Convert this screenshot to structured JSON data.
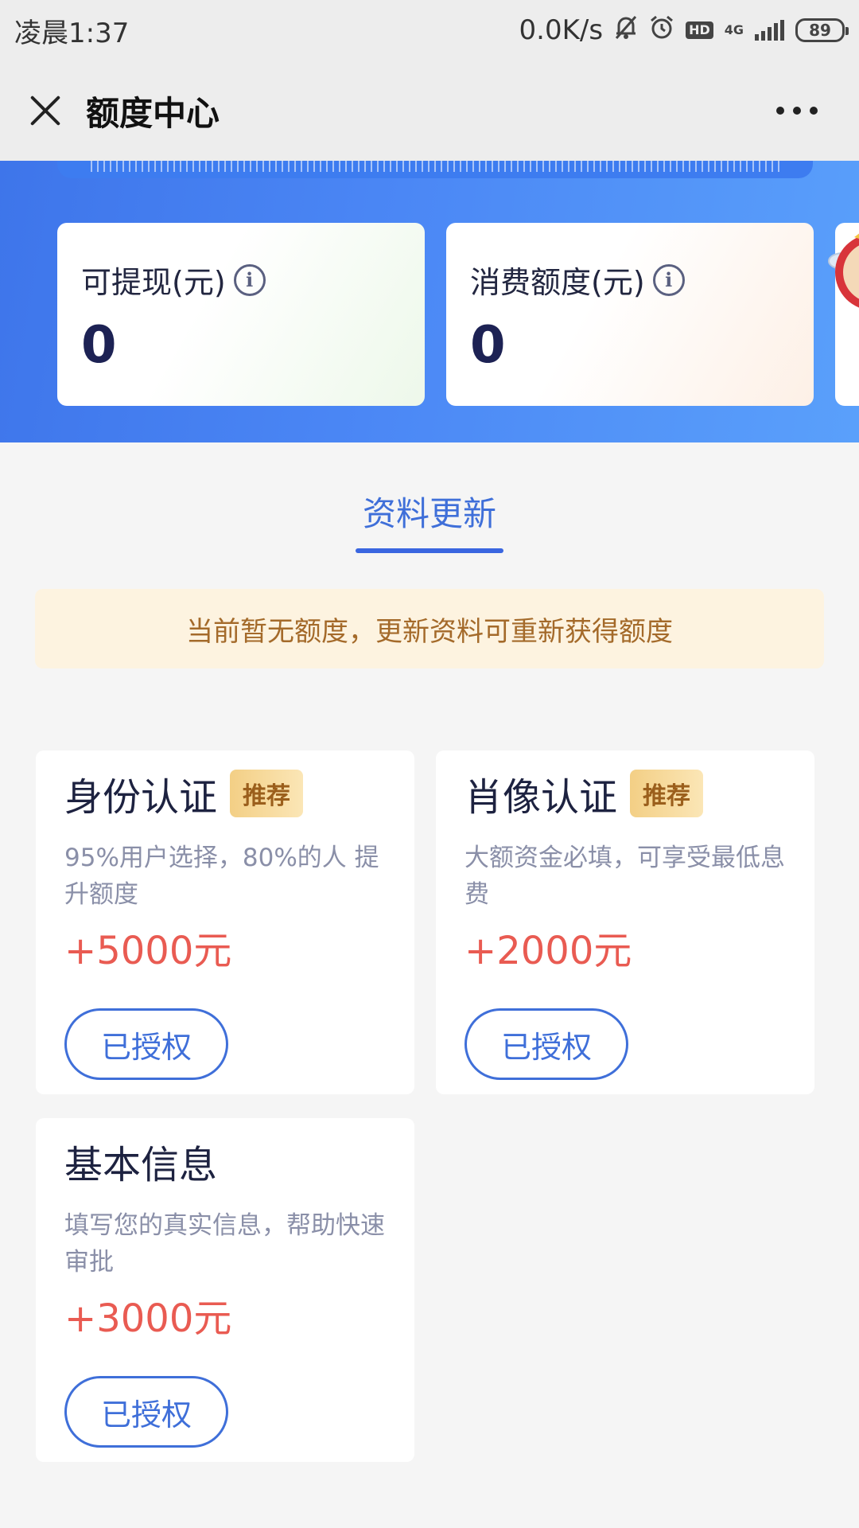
{
  "status_bar": {
    "time": "凌晨1:37",
    "speed": "0.0K/s",
    "network": "4G",
    "hd": "HD",
    "battery": "89"
  },
  "nav": {
    "title": "额度中心"
  },
  "balances": [
    {
      "label": "可提现(元)",
      "value": "0"
    },
    {
      "label": "消费额度(元)",
      "value": "0"
    }
  ],
  "tab": {
    "label": "资料更新"
  },
  "notice": "当前暂无额度，更新资料可重新获得额度",
  "auth_cards": [
    {
      "title": "身份认证",
      "badge": "推荐",
      "desc": "95%用户选择，80%的人 提升额度",
      "bonus": "+5000元",
      "button": "已授权"
    },
    {
      "title": "肖像认证",
      "badge": "推荐",
      "desc": "大额资金必填，可享受最低息费",
      "bonus": "+2000元",
      "button": "已授权"
    },
    {
      "title": "基本信息",
      "desc": "填写您的真实信息，帮助快速审批",
      "bonus": "+3000元",
      "button": "已授权"
    }
  ],
  "colors": {
    "accent": "#3f6fd9",
    "bonus": "#e95b52",
    "notice_text": "#a46a2a",
    "banner": "#4b87f5"
  }
}
